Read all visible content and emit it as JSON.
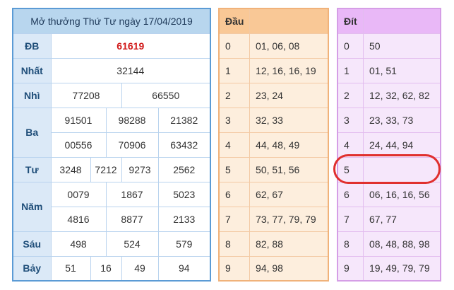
{
  "main": {
    "title": "Mở thưởng Thứ Tư ngày 17/04/2019",
    "rows": {
      "db": {
        "label": "ĐB",
        "values": [
          "61619"
        ]
      },
      "nhat": {
        "label": "Nhất",
        "values": [
          "32144"
        ]
      },
      "nhi": {
        "label": "Nhì",
        "values": [
          "77208",
          "66550"
        ]
      },
      "ba": {
        "label": "Ba",
        "values": [
          "91501",
          "98288",
          "21382",
          "00556",
          "70906",
          "63432"
        ]
      },
      "tu": {
        "label": "Tư",
        "values": [
          "3248",
          "7212",
          "9273",
          "2562"
        ]
      },
      "nam": {
        "label": "Năm",
        "values": [
          "0079",
          "1867",
          "5023",
          "4816",
          "8877",
          "2133"
        ]
      },
      "sau": {
        "label": "Sáu",
        "values": [
          "498",
          "524",
          "579"
        ]
      },
      "bay": {
        "label": "Bảy",
        "values": [
          "51",
          "16",
          "49",
          "94"
        ]
      }
    },
    "colors": {
      "border": "#5b9bd5",
      "header_bg": "#b8d6ee",
      "db_text": "#d11a1a"
    }
  },
  "dau": {
    "header": "Đầu",
    "rows": [
      {
        "key": "0",
        "value": "01, 06, 08"
      },
      {
        "key": "1",
        "value": "12, 16, 16, 19"
      },
      {
        "key": "2",
        "value": "23, 24"
      },
      {
        "key": "3",
        "value": "32, 33"
      },
      {
        "key": "4",
        "value": "44, 48, 49"
      },
      {
        "key": "5",
        "value": "50, 51, 56"
      },
      {
        "key": "6",
        "value": "62, 67"
      },
      {
        "key": "7",
        "value": "73, 77, 79, 79"
      },
      {
        "key": "8",
        "value": "82, 88"
      },
      {
        "key": "9",
        "value": "94, 98"
      }
    ]
  },
  "dit": {
    "header": "Đít",
    "rows": [
      {
        "key": "0",
        "value": "50"
      },
      {
        "key": "1",
        "value": "01, 51"
      },
      {
        "key": "2",
        "value": "12, 32, 62, 82"
      },
      {
        "key": "3",
        "value": "23, 33, 73"
      },
      {
        "key": "4",
        "value": "24, 44, 94"
      },
      {
        "key": "5",
        "value": ""
      },
      {
        "key": "6",
        "value": "06, 16, 16, 56"
      },
      {
        "key": "7",
        "value": "67, 77"
      },
      {
        "key": "8",
        "value": "08, 48, 88, 98"
      },
      {
        "key": "9",
        "value": "19, 49, 79, 79"
      }
    ],
    "highlight_color": "#e0302e"
  }
}
